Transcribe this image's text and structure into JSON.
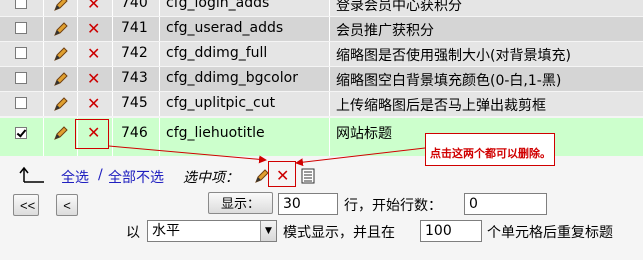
{
  "rows": [
    {
      "id": "740",
      "name": "cfg_login_adds",
      "desc": "登录会员中心获积分",
      "checked": false
    },
    {
      "id": "741",
      "name": "cfg_userad_adds",
      "desc": "会员推广获积分",
      "checked": false
    },
    {
      "id": "742",
      "name": "cfg_ddimg_full",
      "desc": "缩略图是否使用强制大小(对背景填充)",
      "checked": false
    },
    {
      "id": "743",
      "name": "cfg_ddimg_bgcolor",
      "desc": "缩略图空白背景填充颜色(0-白,1-黑)",
      "checked": false
    },
    {
      "id": "745",
      "name": "cfg_uplitpic_cut",
      "desc": "上传缩略图后是否马上弹出裁剪框",
      "checked": false
    },
    {
      "id": "746",
      "name": "cfg_liehuotitle",
      "desc": "网站标题",
      "checked": true
    }
  ],
  "annotation": {
    "text": "点击这两个都可以删除。"
  },
  "toolbar": {
    "select_all": "全选",
    "separator": "/",
    "deselect_all": "全部不选",
    "with_selected": "选中项："
  },
  "nav": {
    "first": "<<",
    "prev": "<",
    "show_label": "显示：",
    "rows_value": "30",
    "rows_start_label": "行，开始行数：",
    "start_value": "0",
    "with_label": "以",
    "mode_value": "水平",
    "mode_suffix": "模式显示，并且在",
    "repeat_value": "100",
    "repeat_suffix": "个单元格后重复标题"
  },
  "colors": {
    "selected_row": "#ccffcc",
    "annotation_red": "#d00000",
    "link": "#2020c0"
  }
}
